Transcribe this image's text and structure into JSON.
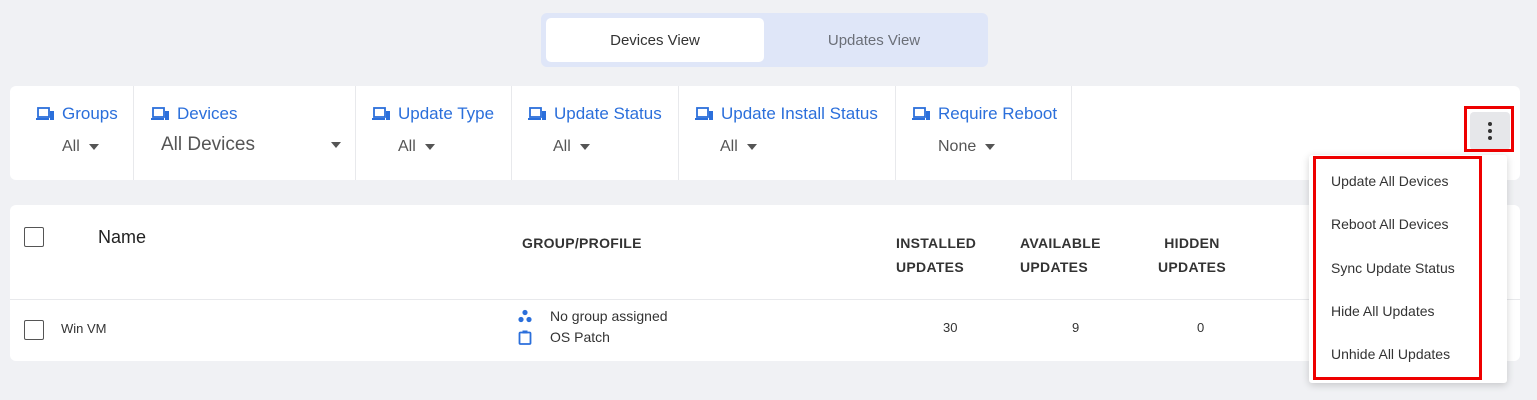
{
  "view_toggle": {
    "devices_view": "Devices View",
    "updates_view": "Updates View"
  },
  "filters": {
    "groups": {
      "label": "Groups",
      "value": "All"
    },
    "devices": {
      "label": "Devices",
      "value": "All Devices"
    },
    "update_type": {
      "label": "Update Type",
      "value": "All"
    },
    "update_status": {
      "label": "Update Status",
      "value": "All"
    },
    "update_install_status": {
      "label": "Update Install Status",
      "value": "All"
    },
    "require_reboot": {
      "label": "Require Reboot",
      "value": "None"
    }
  },
  "table": {
    "headers": {
      "name": "Name",
      "group_profile": "GROUP/PROFILE",
      "installed_1": "INSTALLED",
      "installed_2": "UPDATES",
      "available_1": "AVAILABLE",
      "available_2": "UPDATES",
      "hidden_1": "HIDDEN",
      "hidden_2": "UPDATES"
    },
    "rows": [
      {
        "name": "Win VM",
        "group": "No group assigned",
        "profile": "OS Patch",
        "installed": "30",
        "available": "9",
        "hidden": "0"
      }
    ]
  },
  "menu": {
    "items": [
      "Update All Devices",
      "Reboot All Devices",
      "Sync Update Status",
      "Hide All Updates",
      "Unhide All Updates"
    ]
  },
  "colors": {
    "accent": "#2b6fdb",
    "highlight": "#ee0000",
    "background": "#f0f1f4"
  }
}
